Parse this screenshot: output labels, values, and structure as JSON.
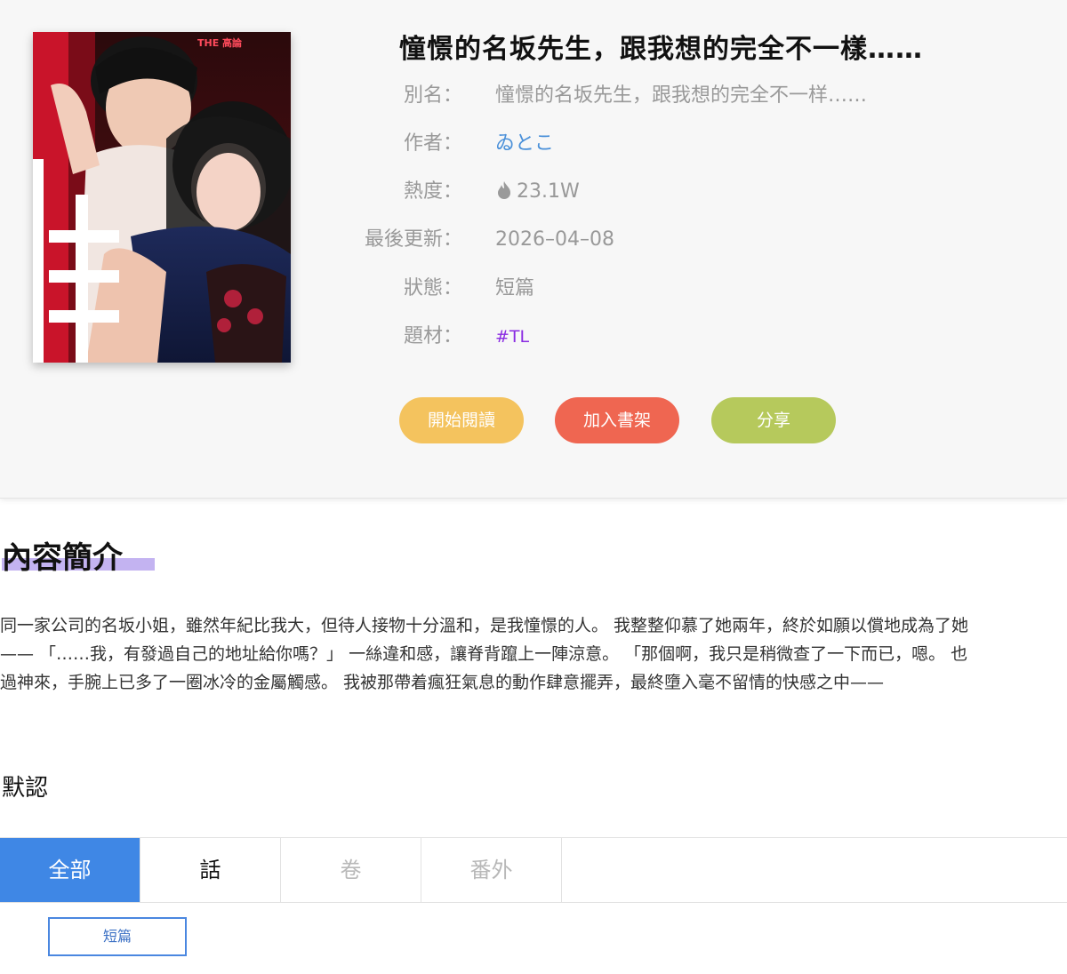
{
  "book": {
    "title": "憧憬的名坂先生，跟我想的完全不一樣……",
    "cover_title_logo": "THE 高論",
    "fields": {
      "alias": {
        "label": "別名：",
        "value": "憧憬的名坂先生，跟我想的完全不一样……"
      },
      "author": {
        "label": "作者：",
        "value": "ゐとこ"
      },
      "heat": {
        "label": "熱度：",
        "value": "23.1W",
        "icon": "flame-icon"
      },
      "updated": {
        "label": "最後更新：",
        "value": "2026–04–08"
      },
      "status": {
        "label": "狀態：",
        "value": "短篇"
      },
      "genre": {
        "label": "題材：",
        "value": "#TL"
      }
    }
  },
  "actions": {
    "read": "開始閱讀",
    "shelf": "加入書架",
    "share": "分享"
  },
  "intro": {
    "heading": "內容簡介",
    "lines": [
      "同一家公司的名坂小姐，雖然年紀比我大，但待人接物十分溫和，是我憧憬的人。 我整整仰慕了她兩年，終於如願以償地成為了她",
      "—— 「……我，有發過自己的地址給你嗎？」 一絲違和感，讓脊背躥上一陣涼意。 「那個啊，我只是稍微查了一下而已，嗯。 也",
      "過神來，手腕上已多了一圈冰冷的金屬觸感。 我被那帶着瘋狂氣息的動作肆意擺弄，最終墮入毫不留情的快感之中——"
    ]
  },
  "chapters": {
    "sort_label": "默認",
    "tabs": [
      {
        "label": "全部",
        "state": "active"
      },
      {
        "label": "話",
        "state": "normal"
      },
      {
        "label": "卷",
        "state": "muted"
      },
      {
        "label": "番外",
        "state": "muted"
      }
    ],
    "items": [
      "短篇"
    ]
  },
  "colors": {
    "read_button": "#f4c35e",
    "shelf_button": "#ef6651",
    "share_button": "#b6c95c",
    "active_tab": "#3f87e5",
    "author_link": "#4a90d9",
    "genre_tag": "#8a2be2"
  }
}
